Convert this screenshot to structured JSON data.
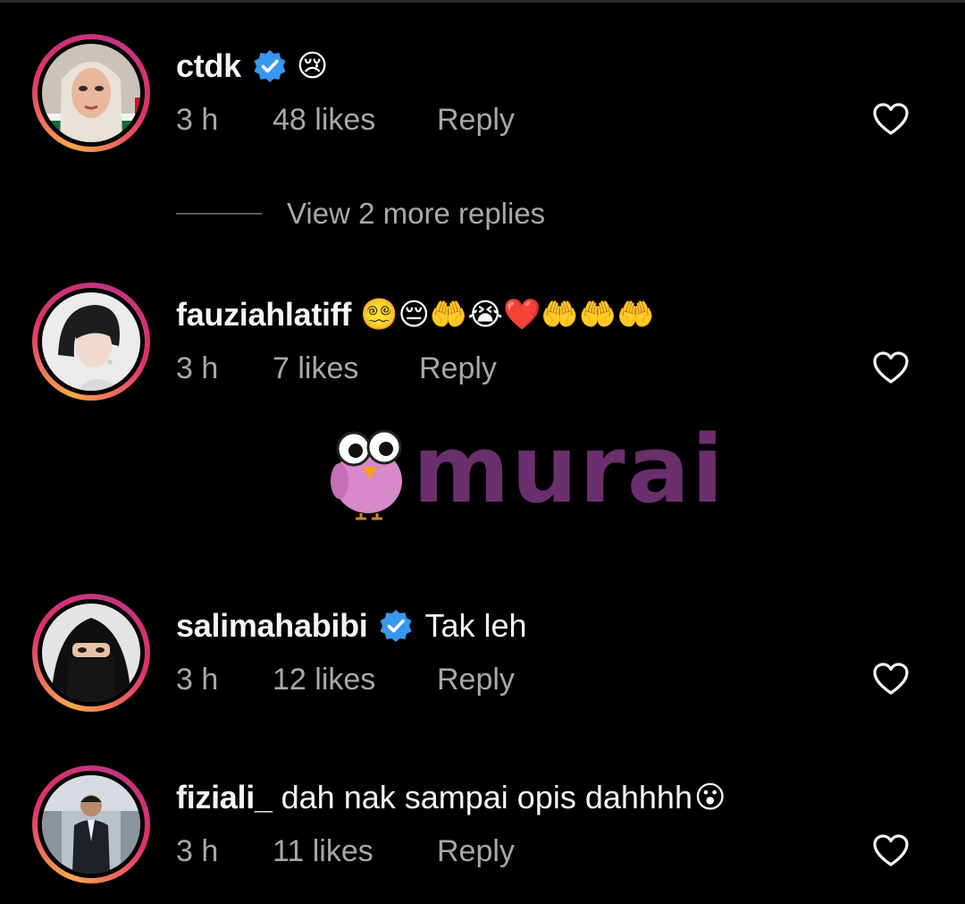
{
  "comments": [
    {
      "username": "ctdk",
      "verified": true,
      "text": "",
      "emojis": [
        "😢"
      ],
      "time": "3 h",
      "likes": "48 likes",
      "reply_label": "Reply",
      "avatar_icon": "woman-hijab-avatar"
    },
    {
      "username": "fauziahlatiff",
      "verified": false,
      "text": "",
      "emojis": [
        "😵‍💫",
        "😔",
        "🤲",
        "😭",
        "❤️",
        "🤲",
        "🤲",
        "🤲"
      ],
      "time": "3 h",
      "likes": "7 likes",
      "reply_label": "Reply",
      "avatar_icon": "woman-short-hair-avatar"
    },
    {
      "username": "salimahabibi",
      "verified": true,
      "text": "Tak leh",
      "emojis": [],
      "time": "3 h",
      "likes": "12 likes",
      "reply_label": "Reply",
      "avatar_icon": "woman-niqab-avatar"
    },
    {
      "username": "fiziali_",
      "verified": false,
      "text": "dah nak sampai opis dahhhh",
      "emojis": [
        "😮"
      ],
      "time": "3 h",
      "likes": "11 likes",
      "reply_label": "Reply",
      "avatar_icon": "man-suit-avatar"
    }
  ],
  "view_more_replies": "View 2 more replies",
  "watermark_text": "murai",
  "colors": {
    "background": "#000000",
    "username": "#f5f5f5",
    "meta": "#a8a8a8",
    "verified": "#3897f0",
    "watermark": "#6b2f6e",
    "watermark_bird": "#d889c9"
  }
}
